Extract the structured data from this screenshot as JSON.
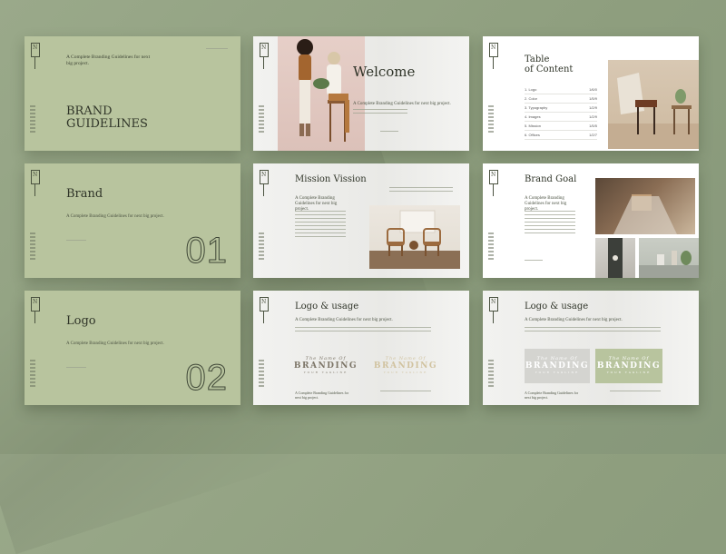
{
  "slides": {
    "s1": {
      "tagline": "A Complete Branding Guidelines for next big project.",
      "title_line1": "BRAND",
      "title_line2": "GUIDELINES",
      "mark": "N"
    },
    "s2": {
      "title": "Welcome",
      "body": "A Complete Branding Guidelines for next big project.",
      "mark": "N"
    },
    "s3": {
      "title_line1": "Table",
      "title_line2": "of Content",
      "mark": "N",
      "rows": [
        {
          "label": "1. Logo",
          "page": "1/6/0"
        },
        {
          "label": "2. Color",
          "page": "1/5/9"
        },
        {
          "label": "3. Typography",
          "page": "1/2/9"
        },
        {
          "label": "4. Images",
          "page": "1/2/9"
        },
        {
          "label": "5. Mission",
          "page": "1/5/5"
        },
        {
          "label": "6. Offices",
          "page": "1/2/7"
        }
      ]
    },
    "s4": {
      "title": "Brand",
      "body": "A Complete Branding Guidelines for next big project.",
      "number": "01",
      "mark": "N"
    },
    "s5": {
      "title": "Mission Vission",
      "body": "A Complete Branding Guidelines for next big project.",
      "mark": "N"
    },
    "s6": {
      "title": "Brand Goal",
      "body": "A Complete Branding Guidelines for next big project.",
      "mark": "N"
    },
    "s7": {
      "title": "Logo",
      "body": "A Complete Branding Guidelines for next big project.",
      "number": "02",
      "mark": "N"
    },
    "s8": {
      "title": "Logo & usage",
      "body": "A Complete Branding Guidelines for next big project.",
      "logo_script": "The Name Of",
      "logo_word": "BRANDING",
      "logo_sub": "YOUR TAGLINE",
      "caption": "A Complete Branding Guidelines for next big project.",
      "mark": "N"
    },
    "s9": {
      "title": "Logo & usage",
      "body": "A Complete Branding Guidelines for next big project.",
      "logo_script": "The Name Of",
      "logo_word": "BRANDING",
      "logo_sub": "YOUR TAGLINE",
      "caption": "A Complete Branding Guidelines for next big project.",
      "mark": "N"
    }
  },
  "colors": {
    "sage": "#b8c49e",
    "background": "#8e9e7e",
    "ink": "#2f3428"
  }
}
